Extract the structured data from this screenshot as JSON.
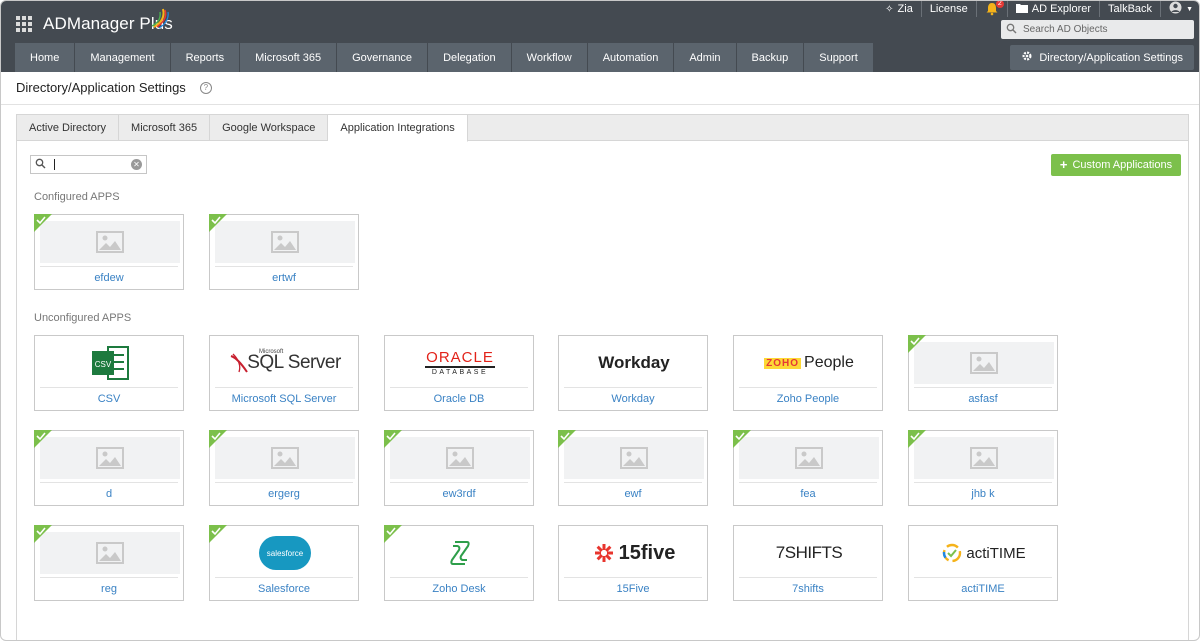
{
  "app": {
    "title": "ADManager Plus"
  },
  "topbar": {
    "zia": "Zia",
    "license": "License",
    "notification_count": "2",
    "ad_explorer": "AD Explorer",
    "talkback": "TalkBack",
    "search_placeholder": "Search AD Objects"
  },
  "nav": {
    "items": [
      "Home",
      "Management",
      "Reports",
      "Microsoft 365",
      "Governance",
      "Delegation",
      "Workflow",
      "Automation",
      "Admin",
      "Backup",
      "Support"
    ],
    "settings_label": "Directory/Application Settings"
  },
  "page": {
    "title": "Directory/Application Settings"
  },
  "tabs": [
    "Active Directory",
    "Microsoft 365",
    "Google Workspace",
    "Application Integrations"
  ],
  "active_tab": "Application Integrations",
  "search": {
    "value": ""
  },
  "custom_button": "Custom Applications",
  "sections": {
    "configured": {
      "label": "Configured APPS",
      "apps": [
        {
          "name": "efdew",
          "logo": "placeholder-image-icon",
          "configured": true
        },
        {
          "name": "ertwf",
          "logo": "placeholder-image-icon",
          "configured": true
        }
      ]
    },
    "unconfigured": {
      "label": "Unconfigured APPS",
      "apps": [
        {
          "name": "CSV",
          "logo": "csv-logo",
          "configured": false
        },
        {
          "name": "Microsoft SQL Server",
          "logo": "sql-server-logo",
          "logo_text": "SQL Server",
          "logo_small": "Microsoft",
          "configured": false
        },
        {
          "name": "Oracle DB",
          "logo": "oracle-logo",
          "logo_text": "ORACLE",
          "logo_small": "DATABASE",
          "configured": false
        },
        {
          "name": "Workday",
          "logo": "workday-logo",
          "logo_text": "Workday",
          "configured": false
        },
        {
          "name": "Zoho People",
          "logo": "zoho-people-logo",
          "logo_text": "People",
          "logo_small": "ZOHO",
          "configured": false
        },
        {
          "name": "asfasf",
          "logo": "placeholder-image-icon",
          "configured": true
        },
        {
          "name": "d",
          "logo": "placeholder-image-icon",
          "configured": true
        },
        {
          "name": "ergerg",
          "logo": "placeholder-image-icon",
          "configured": true
        },
        {
          "name": "ew3rdf",
          "logo": "placeholder-image-icon",
          "configured": true
        },
        {
          "name": "ewf",
          "logo": "placeholder-image-icon",
          "configured": true
        },
        {
          "name": "fea",
          "logo": "placeholder-image-icon",
          "configured": true
        },
        {
          "name": "jhb k",
          "logo": "placeholder-image-icon",
          "configured": true
        },
        {
          "name": "reg",
          "logo": "placeholder-image-icon",
          "configured": true
        },
        {
          "name": "Salesforce",
          "logo": "salesforce-logo",
          "logo_text": "salesforce",
          "configured": true
        },
        {
          "name": "Zoho Desk",
          "logo": "zoho-desk-logo",
          "configured": true
        },
        {
          "name": "15Five",
          "logo": "15five-logo",
          "logo_text": "15five",
          "configured": false
        },
        {
          "name": "7shifts",
          "logo": "7shifts-logo",
          "logo_text": "7SHIFTS",
          "configured": false
        },
        {
          "name": "actiTIME",
          "logo": "actitime-logo",
          "logo_text": "actiTIME",
          "configured": false
        }
      ]
    }
  },
  "colors": {
    "header": "#444a51",
    "nav": "#5b646d",
    "accent_green": "#7cc04b",
    "link_blue": "#3a82c4"
  }
}
